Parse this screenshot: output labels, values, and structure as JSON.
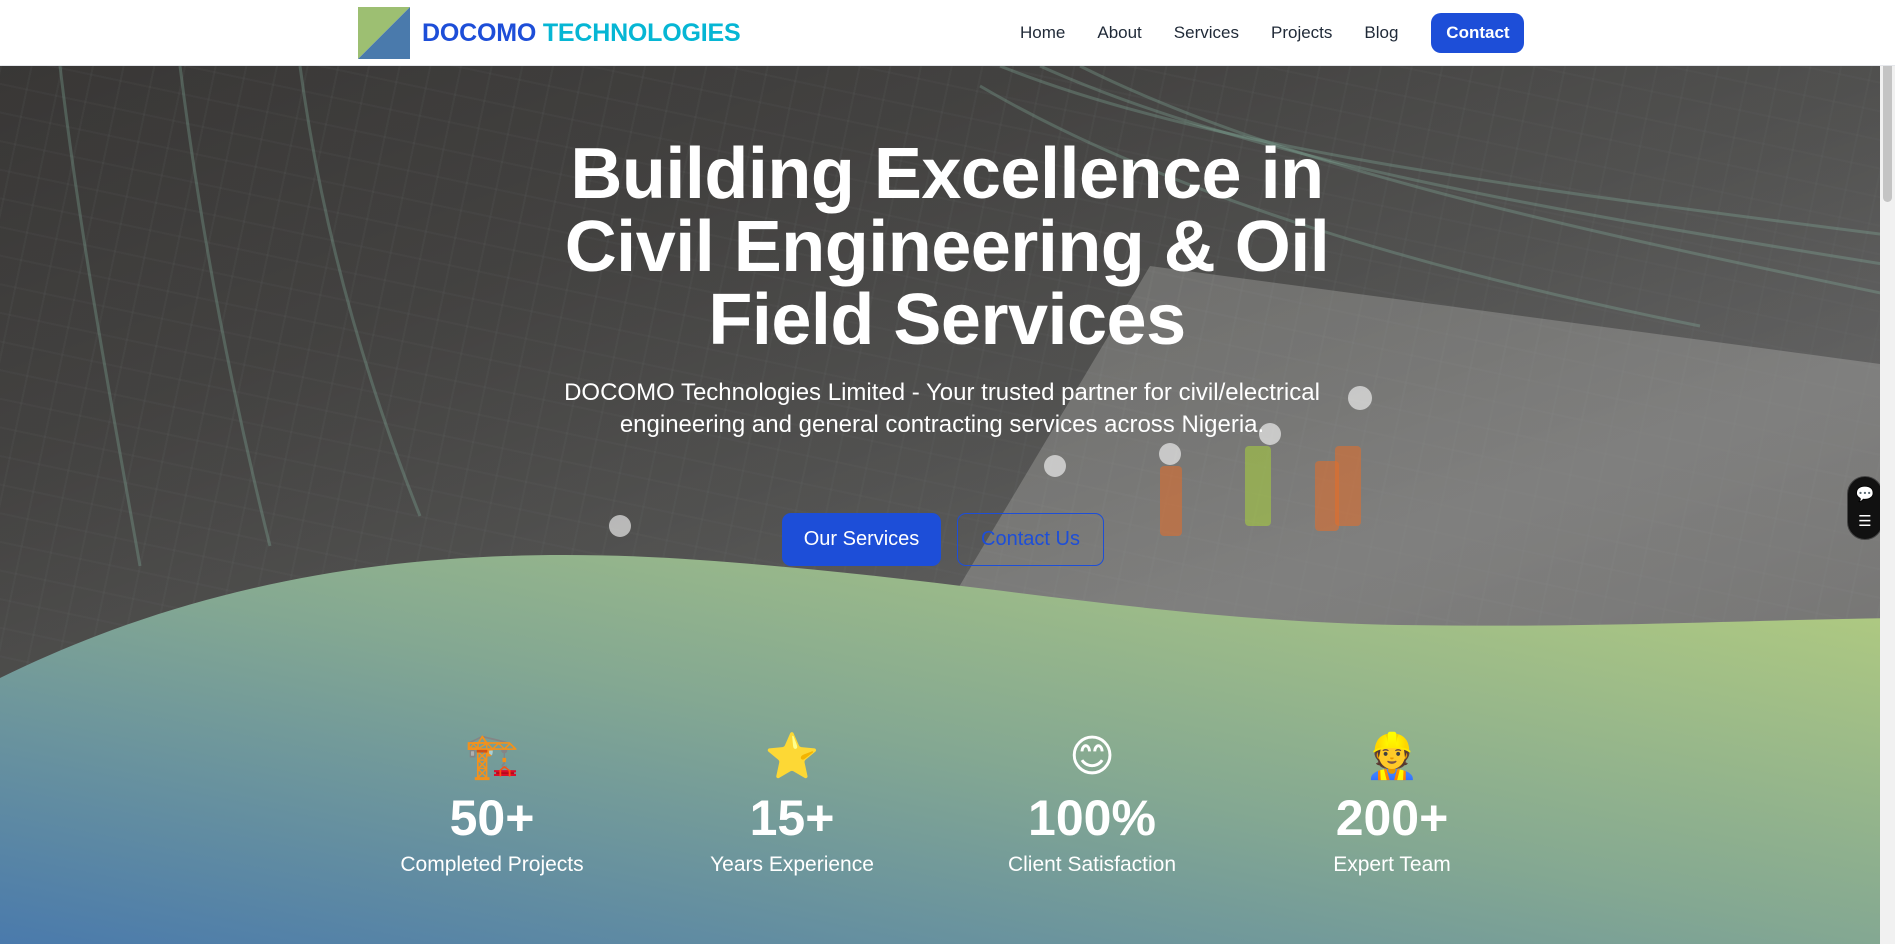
{
  "brand": {
    "name_part1": "DOCOMO",
    "name_part2": "TECHNOLOGIES"
  },
  "nav": {
    "items": [
      {
        "label": "Home"
      },
      {
        "label": "About"
      },
      {
        "label": "Services"
      },
      {
        "label": "Projects"
      },
      {
        "label": "Blog"
      }
    ],
    "cta_label": "Contact"
  },
  "hero": {
    "title_line1": "Building Excellence in",
    "title_line2": "Civil Engineering & Oil",
    "title_line3": "Field Services",
    "subtitle": "DOCOMO Technologies Limited - Your trusted partner for civil/electrical engineering and general contracting services across Nigeria.",
    "primary_button": "Our Services",
    "secondary_button": "Contact Us"
  },
  "stats": [
    {
      "icon": "🏗️",
      "icon_name": "crane-icon",
      "value": "50+",
      "label": "Completed Projects"
    },
    {
      "icon": "⭐",
      "icon_name": "star-icon",
      "value": "15+",
      "label": "Years Experience"
    },
    {
      "icon": "😊",
      "icon_name": "smile-icon",
      "value": "100%",
      "label": "Client Satisfaction"
    },
    {
      "icon": "👷",
      "icon_name": "worker-icon",
      "value": "200+",
      "label": "Expert Team"
    }
  ],
  "side_widget": {
    "chat_icon": "💬",
    "menu_icon": "☰"
  },
  "colors": {
    "primary": "#1d4ed8",
    "accent": "#06b6d4",
    "gradient_start": "#4a7aac",
    "gradient_end": "#b6cf7e"
  }
}
